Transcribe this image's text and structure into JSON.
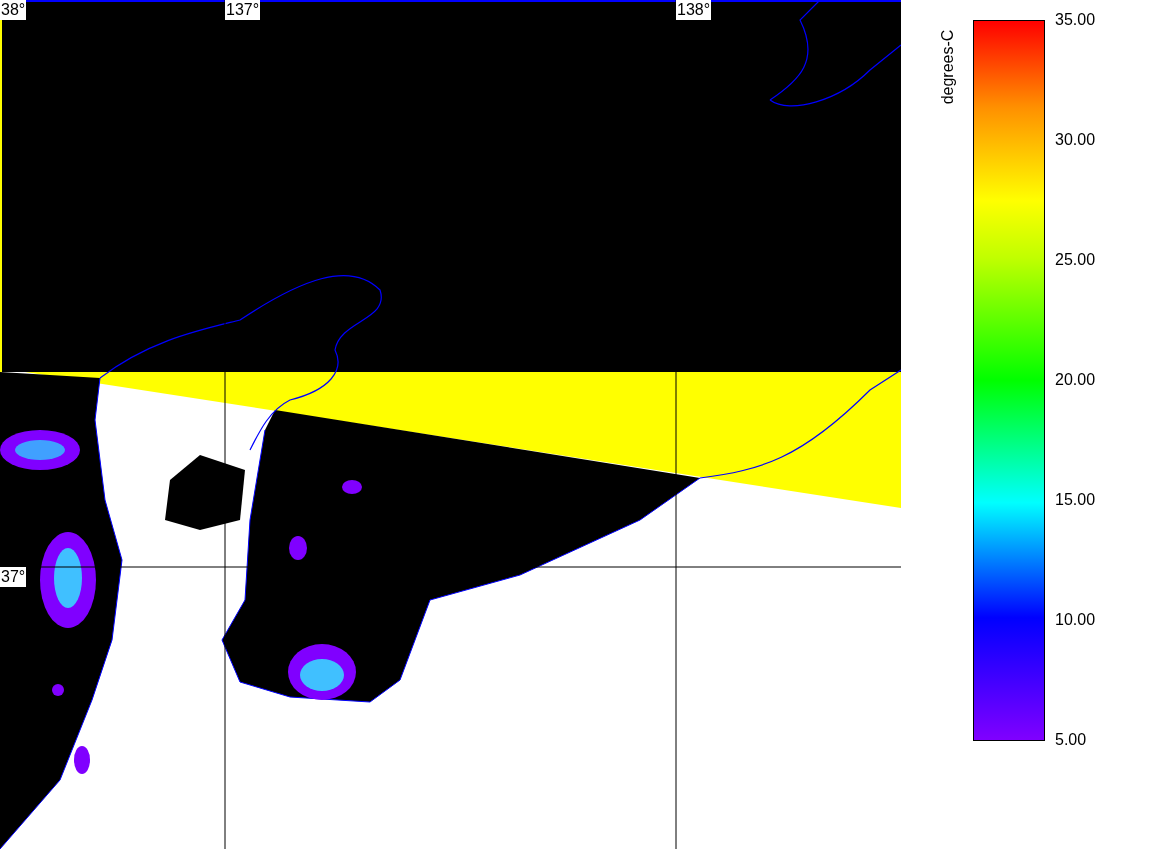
{
  "map": {
    "lat_labels": [
      "38°",
      "37°"
    ],
    "lon_labels": [
      "137°",
      "138°"
    ]
  },
  "colorbar": {
    "label": "degrees-C",
    "ticks": [
      "35.00",
      "30.00",
      "25.00",
      "20.00",
      "15.00",
      "10.00",
      "5.00"
    ]
  }
}
